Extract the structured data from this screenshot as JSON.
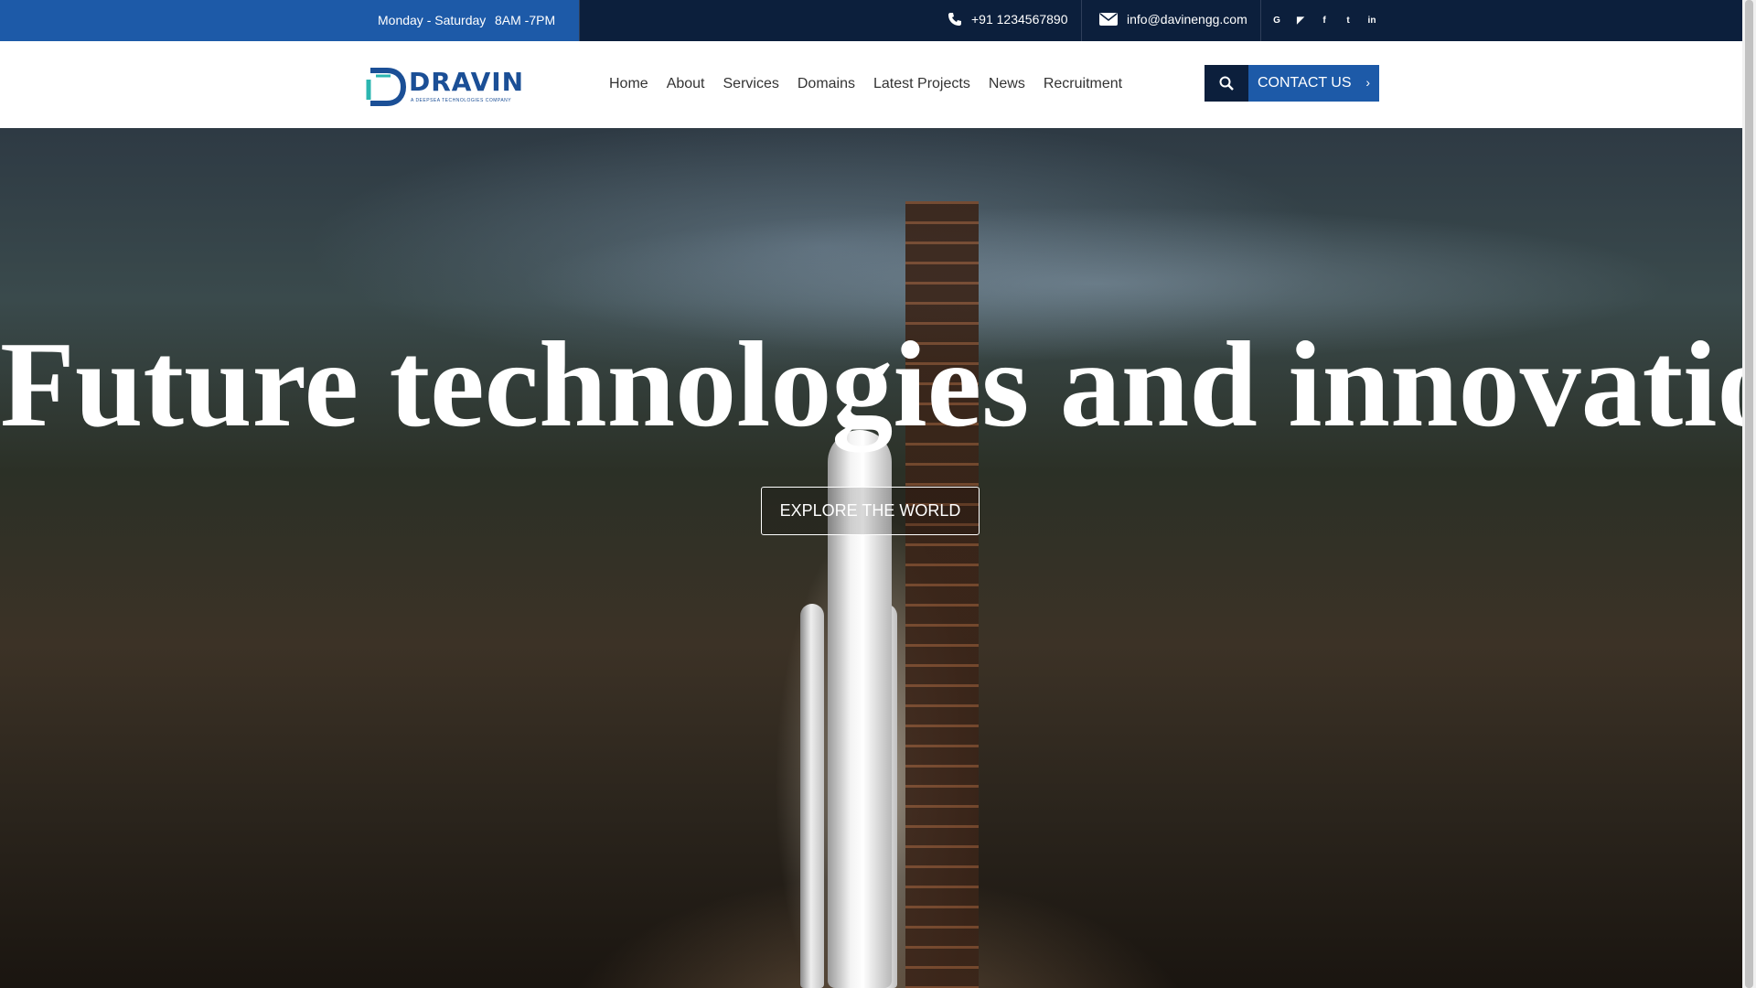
{
  "topbar": {
    "days": "Monday - Saturday",
    "hours": "8AM -7PM",
    "phone": "+91 1234567890",
    "email": "info@davinengg.com",
    "socials": [
      {
        "icon": "google-icon",
        "glyph": "G"
      },
      {
        "icon": "rss-icon",
        "glyph": "◤"
      },
      {
        "icon": "facebook-icon",
        "glyph": "f"
      },
      {
        "icon": "twitter-icon",
        "glyph": "t"
      },
      {
        "icon": "linkedin-icon",
        "glyph": "in"
      }
    ]
  },
  "header": {
    "logo_text": "DRAVIN",
    "logo_tagline": "A DEEPSEA TECHNOLOGIES COMPANY",
    "nav": [
      "Home",
      "About",
      "Services",
      "Domains",
      "Latest Projects",
      "News",
      "Recruitment"
    ],
    "contact_button": "CONTACT US",
    "contact_chevron": "›"
  },
  "hero": {
    "title": "Future technologies and innovations",
    "button": "EXPLORE THE WORLD"
  },
  "colors": {
    "topbar_bg": "#0c1f3c",
    "accent_blue": "#1d5aa8",
    "nav_text": "#333333"
  }
}
